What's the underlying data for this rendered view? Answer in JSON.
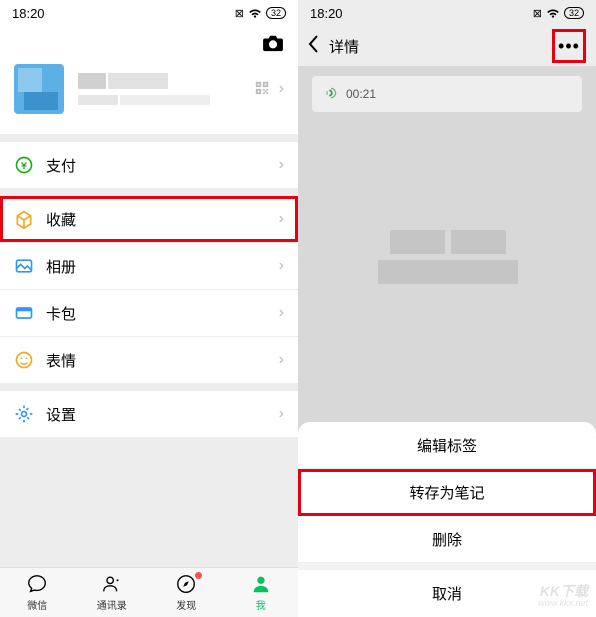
{
  "status": {
    "time": "18:20",
    "battery": "32"
  },
  "left": {
    "menu": {
      "pay": "支付",
      "fav": "收藏",
      "album": "相册",
      "card": "卡包",
      "sticker": "表情",
      "settings": "设置"
    },
    "tabs": {
      "wechat": "微信",
      "contacts": "通讯录",
      "discover": "发现",
      "me": "我"
    }
  },
  "right": {
    "header": {
      "title": "详情"
    },
    "audio": {
      "duration": "00:21"
    },
    "actions": {
      "edit_tag": "编辑标签",
      "save_note": "转存为笔记",
      "delete": "删除",
      "cancel": "取消"
    }
  },
  "watermark": {
    "main": "KK下载",
    "sub": "www.kkx.net"
  },
  "colors": {
    "highlight": "#e60012",
    "wechat_green": "#07c160"
  }
}
